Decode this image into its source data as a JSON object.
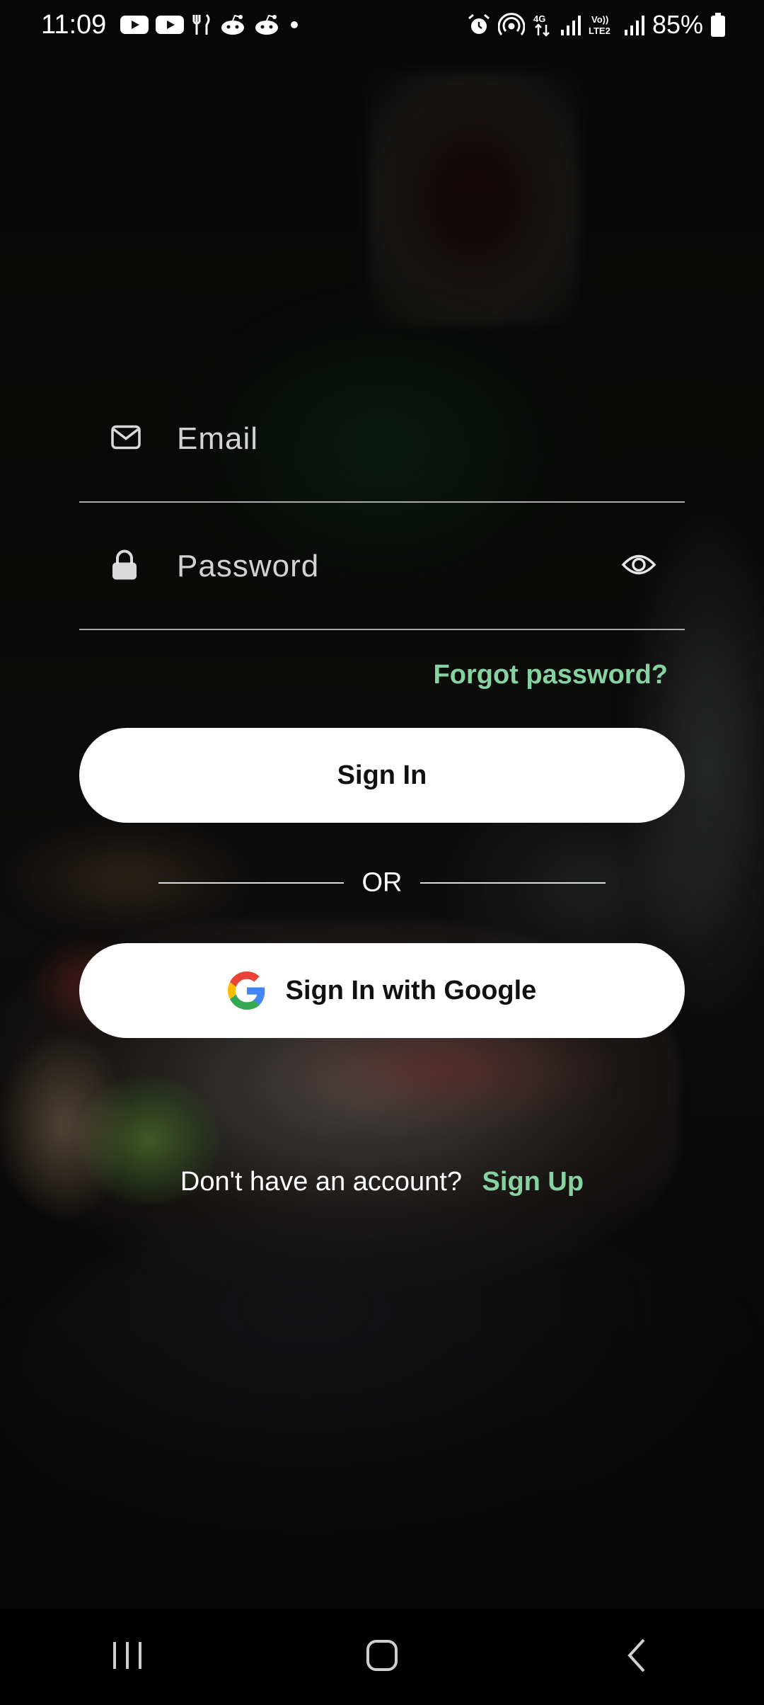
{
  "status_bar": {
    "time": "11:09",
    "battery": "85%",
    "left_icons": [
      "youtube-icon",
      "youtube-icon",
      "restaurant-icon",
      "reddit-icon",
      "reddit-icon",
      "dot-icon"
    ],
    "right_icons": [
      "alarm-icon",
      "hotspot-icon",
      "4g-data-icon",
      "signal-icon",
      "volte-lte2-icon",
      "signal-icon",
      "battery-icon"
    ]
  },
  "form": {
    "email_placeholder": "Email",
    "password_placeholder": "Password",
    "forgot_password": "Forgot password?",
    "sign_in": "Sign In",
    "or": "OR",
    "google_sign_in": "Sign In with Google",
    "no_account": "Don't have an account?",
    "sign_up": "Sign Up"
  },
  "colors": {
    "accent": "#86d2a0",
    "button_bg": "#ffffff",
    "button_text": "#111111"
  }
}
